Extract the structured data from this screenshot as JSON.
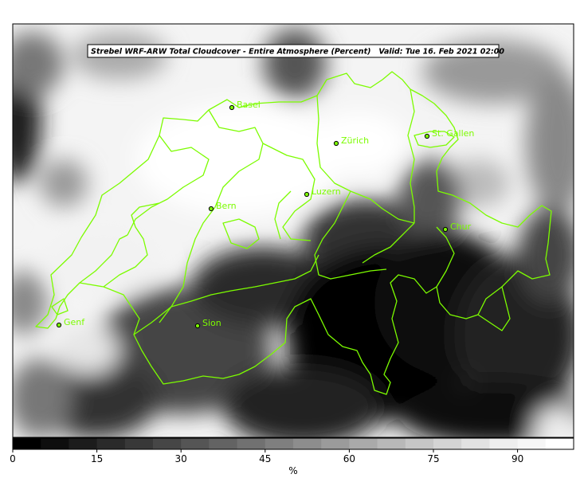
{
  "title": "Strebel WRF-ARW Total Cloudcover - Entire Atmosphere (Percent)   Valid: Tue 16. Feb 2021 02:00",
  "border_color": "#7CFC00",
  "label_color": "#7CFC00",
  "colorbar": {
    "unit": "%",
    "range": [
      0,
      100
    ],
    "ticks": [
      "0",
      "15",
      "30",
      "45",
      "60",
      "75",
      "90"
    ],
    "step": 5,
    "colors": [
      "#000000",
      "#0e0e0e",
      "#1c1c1c",
      "#2a2a2a",
      "#383838",
      "#464646",
      "#555555",
      "#636363",
      "#717171",
      "#7f7f7f",
      "#8d8d8d",
      "#9b9b9b",
      "#aaaaaa",
      "#b8b8b8",
      "#c6c6c6",
      "#d4d4d4",
      "#e2e2e2",
      "#eeeeee",
      "#f6f6f6",
      "#ffffff"
    ]
  },
  "cities": [
    {
      "name": "Basel"
    },
    {
      "name": "Zürich"
    },
    {
      "name": "St. Gallen"
    },
    {
      "name": "Luzern"
    },
    {
      "name": "Bern"
    },
    {
      "name": "Chur"
    },
    {
      "name": "Genf"
    },
    {
      "name": "Sion"
    }
  ]
}
